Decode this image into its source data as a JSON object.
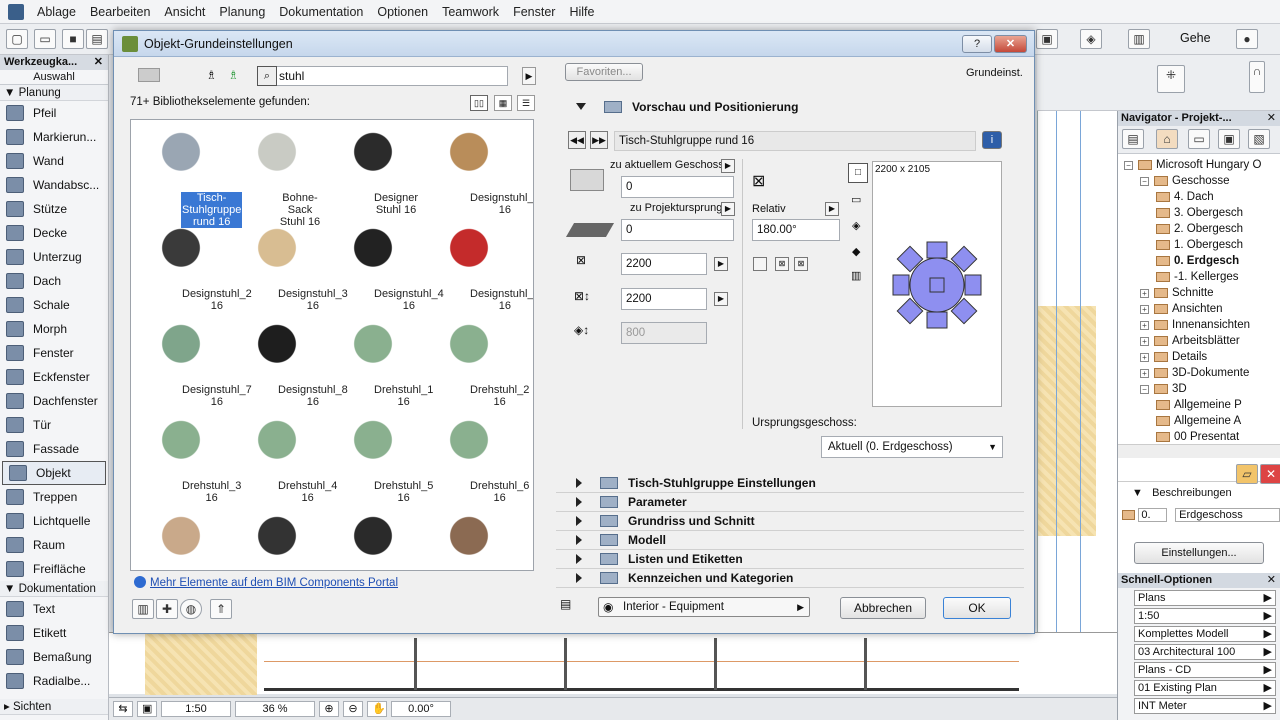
{
  "menubar": [
    "Ablage",
    "Bearbeiten",
    "Ansicht",
    "Planung",
    "Dokumentation",
    "Optionen",
    "Teamwork",
    "Fenster",
    "Hilfe"
  ],
  "toolbox": {
    "title": "Werkzeugka...",
    "select_label": "Auswahl",
    "sections": [
      {
        "name": "Planung",
        "items": [
          "Pfeil",
          "Markierun...",
          "Wand",
          "Wandabsc...",
          "Stütze",
          "Decke",
          "Unterzug",
          "Dach",
          "Schale",
          "Morph",
          "Fenster",
          "Eckfenster",
          "Dachfenster",
          "Tür",
          "Fassade",
          "Objekt",
          "Treppen",
          "Lichtquelle",
          "Raum",
          "Freifläche"
        ]
      },
      {
        "name": "Dokumentation",
        "items": [
          "Text",
          "Etikett",
          "Bemaßung",
          "Radialbe..."
        ]
      }
    ],
    "footer": "Sichten",
    "selected_item": "Objekt"
  },
  "toolbar_right": {
    "gehe_label": "Gehe"
  },
  "dialog": {
    "title": "Objekt-Grundeinstellungen",
    "help_btn": "?",
    "close_btn": "✕",
    "search_value": "stuhl",
    "found_text": "71+ Bibliothekselemente gefunden:",
    "items": [
      {
        "label": "Tisch-Stuhlgruppe rund 16",
        "selected": true,
        "color": "#9aa6b3"
      },
      {
        "label": "Bohne-Sack Stuhl 16",
        "color": "#c9cbc4"
      },
      {
        "label": "Designer Stuhl 16",
        "color": "#2b2b2b"
      },
      {
        "label": "Designstuhl_1 16",
        "color": "#b98d5a"
      },
      {
        "label": "Designstuhl_2 16",
        "color": "#3a3a3a"
      },
      {
        "label": "Designstuhl_3 16",
        "color": "#d8bd92"
      },
      {
        "label": "Designstuhl_4 16",
        "color": "#222222"
      },
      {
        "label": "Designstuhl_5 16",
        "color": "#c42b2b"
      },
      {
        "label": "Designstuhl_7 16",
        "color": "#7fa58b"
      },
      {
        "label": "Designstuhl_8 16",
        "color": "#1e1e1e"
      },
      {
        "label": "Drehstuhl_1 16",
        "color": "#8ab08f"
      },
      {
        "label": "Drehstuhl_2 16",
        "color": "#8ab08f"
      },
      {
        "label": "Drehstuhl_3 16",
        "color": "#8ab08f"
      },
      {
        "label": "Drehstuhl_4 16",
        "color": "#8ab08f"
      },
      {
        "label": "Drehstuhl_5 16",
        "color": "#8ab08f"
      },
      {
        "label": "Drehstuhl_6 16",
        "color": "#8ab08f"
      },
      {
        "label": "",
        "color": "#c9a98a"
      },
      {
        "label": "",
        "color": "#333333"
      },
      {
        "label": "",
        "color": "#2a2a2a"
      },
      {
        "label": "",
        "color": "#8b6a52"
      }
    ],
    "portal_link": "Mehr Elemente auf dem BIM Components Portal",
    "favorites_btn": "Favoriten...",
    "grundeinst": "Grundeinst.",
    "preview_section": "Vorschau und Positionierung",
    "element_name": "Tisch-Stuhlgruppe rund 16",
    "zu_aktuellem": "zu aktuellem Geschoss",
    "val_zu_aktuellem": "0",
    "zu_projekt": "zu Projektursprung",
    "val_zu_projekt": "0",
    "val_width": "2200",
    "val_depth": "2200",
    "val_height": "800",
    "relativ": "Relativ",
    "angle": "180.00°",
    "preview_size": "2200 x 2105",
    "ursprung_label": "Ursprungsgeschoss:",
    "ursprung_value": "Aktuell (0. Erdgeschoss)",
    "sections": [
      "Tisch-Stuhlgruppe Einstellungen",
      "Parameter",
      "Grundriss und Schnitt",
      "Modell",
      "Listen und Etiketten",
      "Kennzeichen und Kategorien"
    ],
    "layer": "Interior - Equipment",
    "cancel_btn": "Abbrechen",
    "ok_btn": "OK"
  },
  "navigator": {
    "title": "Navigator - Projekt-...",
    "tree": [
      {
        "label": "Microsoft Hungary O",
        "level": 0
      },
      {
        "label": "Geschosse",
        "level": 1
      },
      {
        "label": "4. Dach",
        "level": 2
      },
      {
        "label": "3. Obergesch",
        "level": 2
      },
      {
        "label": "2. Obergesch",
        "level": 2
      },
      {
        "label": "1. Obergesch",
        "level": 2
      },
      {
        "label": "0. Erdgesch",
        "level": 2,
        "bold": true
      },
      {
        "label": "-1. Kellerges",
        "level": 2
      },
      {
        "label": "Schnitte",
        "level": 1
      },
      {
        "label": "Ansichten",
        "level": 1
      },
      {
        "label": "Innenansichten",
        "level": 1
      },
      {
        "label": "Arbeitsblätter",
        "level": 1
      },
      {
        "label": "Details",
        "level": 1
      },
      {
        "label": "3D-Dokumente",
        "level": 1
      },
      {
        "label": "3D",
        "level": 1
      },
      {
        "label": "Allgemeine P",
        "level": 2
      },
      {
        "label": "Allgemeine A",
        "level": 2
      },
      {
        "label": "00 Presentat",
        "level": 2
      }
    ],
    "beschreibungen": "Beschreibungen",
    "geschoss_num": "0.",
    "geschoss_name": "Erdgeschoss",
    "einstellungen_btn": "Einstellungen..."
  },
  "quick": {
    "title": "Schnell-Optionen",
    "options": [
      "Plans",
      "1:50",
      "Komplettes Modell",
      "03 Architectural 100",
      "Plans - CD",
      "01 Existing Plan",
      "INT Meter"
    ]
  },
  "status": {
    "scale": "1:50",
    "zoom": "36 %",
    "angle": "0.00°"
  }
}
